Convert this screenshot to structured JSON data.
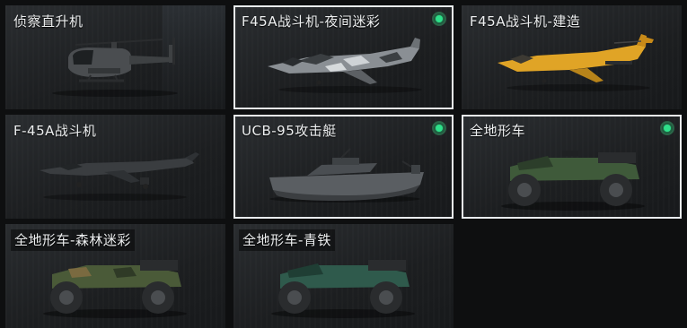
{
  "cards": [
    {
      "title": "侦察直升机",
      "equipped": false,
      "selected": false
    },
    {
      "title": "F45A战斗机-夜间迷彩",
      "equipped": true,
      "selected": true
    },
    {
      "title": "F45A战斗机-建造",
      "equipped": false,
      "selected": false
    },
    {
      "title": "F-45A战斗机",
      "equipped": false,
      "selected": false
    },
    {
      "title": "UCB-95攻击艇",
      "equipped": true,
      "selected": true
    },
    {
      "title": "全地形车",
      "equipped": true,
      "selected": true
    },
    {
      "title": "全地形车-森林迷彩",
      "equipped": false,
      "selected": false
    },
    {
      "title": "全地形车-青铁",
      "equipped": false,
      "selected": false
    }
  ],
  "colors": {
    "equipped_indicator": "#2fe08a",
    "selected_border": "#e9ecee",
    "night_camo": "#8a8f94",
    "construction": "#e0a426",
    "standard_jet": "#3a3d40",
    "boat": "#5a5e62",
    "atv_green": "#3f5a3a",
    "atv_forest": "#4a5a38",
    "atv_teal": "#2f5a4c"
  },
  "icons": {
    "equipped_indicator": "green-dot-icon"
  }
}
